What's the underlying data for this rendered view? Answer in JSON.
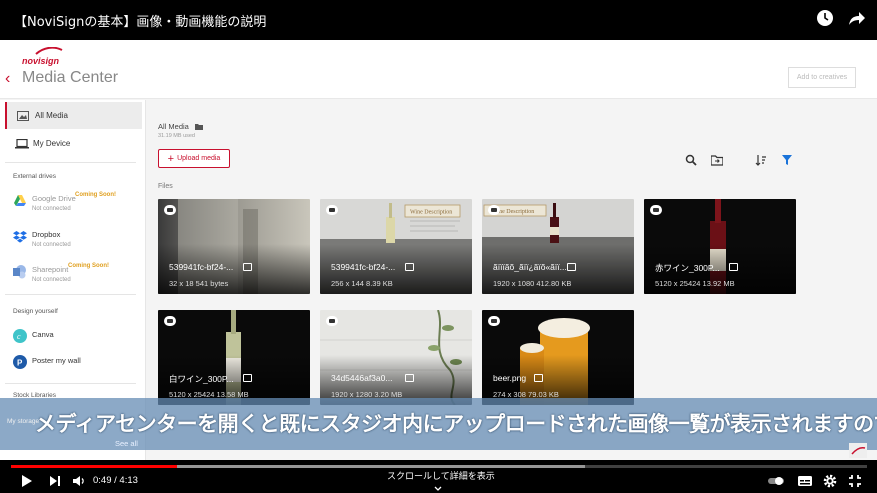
{
  "video": {
    "title": "【NoviSignの基本】画像・動画機能の説明",
    "time_current": "0:49",
    "time_separator": "/",
    "time_total": "4:13",
    "progress_fraction": 0.194,
    "buffered_fraction": 0.67,
    "more_info_label": "スクロールして詳細を表示",
    "caption": "メディアセンターを開くと既にスタジオ内にアップロードされた画像一覧が表示されますので"
  },
  "app": {
    "logo": "novisign",
    "title": "Media Center",
    "add_to_creatives": "Add to creatives",
    "accent_color": "#c8102e"
  },
  "sidebar": {
    "all_media": "All Media",
    "my_device": "My Device",
    "external_drives_heading": "External drives",
    "drives": [
      {
        "name": "Google Drive",
        "status": "Not connected",
        "badge": "Coming Soon!"
      },
      {
        "name": "Dropbox",
        "status": "Not connected",
        "badge": ""
      },
      {
        "name": "Sharepoint",
        "status": "Not connected",
        "badge": "Coming Soon!"
      }
    ],
    "design_yourself_heading": "Design yourself",
    "canva": "Canva",
    "poster_my_wall": "Poster my wall",
    "stock_libraries_heading": "Stock Libraries",
    "my_storage": "My storage",
    "see_all": "See all"
  },
  "main": {
    "breadcrumb": "All Media",
    "used": "31.19 MB used",
    "upload_label": "Upload media",
    "files_label": "Files",
    "files": [
      {
        "name": "539941fc-bf24-...",
        "size": "32 x 18   541 bytes"
      },
      {
        "name": "539941fc-bf24-...",
        "size": "256 x 144   8.39 KB"
      },
      {
        "name": "ãïïïãõ_ãïï¿ãïõ«ãïï...",
        "size": "1920 x 1080   412.80 KB"
      },
      {
        "name": "赤ワイン_300P...",
        "size": "5120 x 25424   13.92 MB"
      },
      {
        "name": "白ワイン_300P...",
        "size": "5120 x 25424   13.58 MB"
      },
      {
        "name": "34d5446af3a0...",
        "size": "1920 x 1280   3.20 MB"
      },
      {
        "name": "beer.png",
        "size": "274 x 308   79.03 KB"
      }
    ]
  }
}
